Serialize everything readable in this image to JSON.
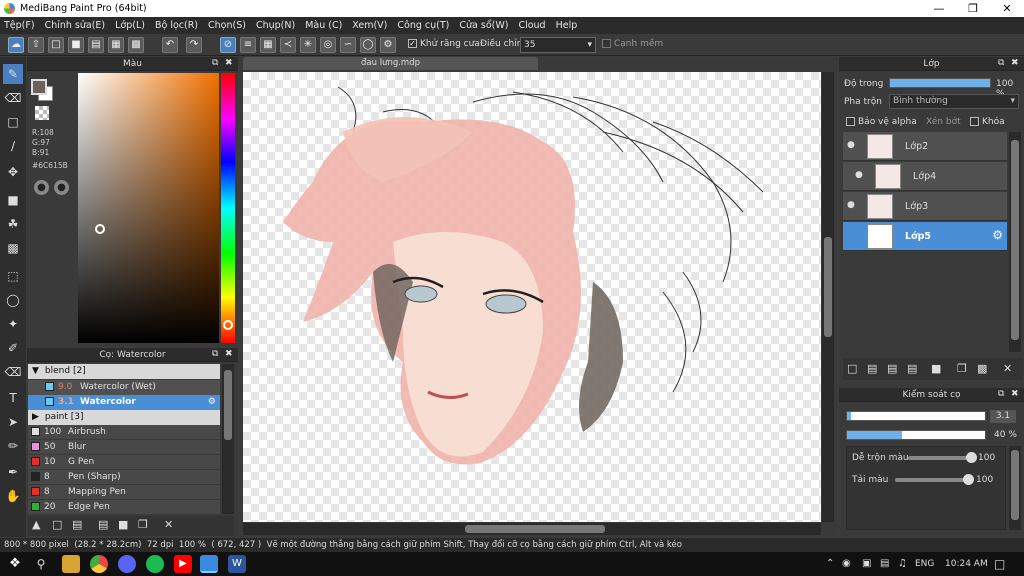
{
  "window": {
    "title": "MediBang Paint Pro (64bit)"
  },
  "menu": [
    "Tệp(F)",
    "Chỉnh sửa(E)",
    "Lớp(L)",
    "Bộ lọc(R)",
    "Chọn(S)",
    "Chụp(N)",
    "Màu (C)",
    "Xem(V)",
    "Công cụ(T)",
    "Cửa sổ(W)",
    "Cloud",
    "Help"
  ],
  "toolbar": {
    "antialias_label": "Khử răng cưa",
    "adjust_label": "Điều chỉnh",
    "adjust_value": "35",
    "smooth_edge_label": "Cạnh mềm"
  },
  "color_panel": {
    "title": "Màu",
    "r": "R:108",
    "g": "G:97",
    "b": "B:91",
    "hex": "#6C615B",
    "primary_color": "#6c615b",
    "secondary_color": "#ffffff"
  },
  "brush_panel": {
    "title": "Cọ: Watercolor",
    "groups": [
      {
        "name": "blend [2]",
        "expanded": true
      },
      {
        "name": "paint [3]",
        "expanded": false
      }
    ],
    "blend_items": [
      {
        "size": "9.0",
        "name": "Watercolor (Wet)",
        "color": "#6ec9f0",
        "selected": false
      },
      {
        "size": "3.1",
        "name": "Watercolor",
        "color": "#6ec9f0",
        "selected": true
      }
    ],
    "items": [
      {
        "size": "100",
        "name": "Airbrush",
        "color": "#dddddd"
      },
      {
        "size": "50",
        "name": "Blur",
        "color": "#e890e0"
      },
      {
        "size": "10",
        "name": "G Pen",
        "color": "#e03030"
      },
      {
        "size": "8",
        "name": "Pen (Sharp)",
        "color": "#222222"
      },
      {
        "size": "8",
        "name": "Mapping Pen",
        "color": "#e03030"
      },
      {
        "size": "20",
        "name": "Edge Pen",
        "color": "#30b030"
      }
    ]
  },
  "canvas": {
    "tab_title": "đau lưng.mdp"
  },
  "layer_panel": {
    "title": "Lớp",
    "opacity_label": "Độ trong",
    "opacity_value": "100 %",
    "opacity_fraction": 1.0,
    "blend_label": "Pha trộn",
    "blend_value": "Bình thường",
    "protect_alpha_label": "Bảo vệ alpha",
    "clipping_label": "Xén bớt",
    "lock_label": "Khóa",
    "layers": [
      {
        "name": "Lớp2",
        "selected": false
      },
      {
        "name": "Lớp4",
        "selected": false
      },
      {
        "name": "Lớp3",
        "selected": false
      },
      {
        "name": "Lớp5",
        "selected": true
      }
    ]
  },
  "brush_control": {
    "title": "Kiểm soát cọ",
    "size_value": "3.1",
    "size_fraction": 0.03,
    "opacity_value": "40 %",
    "opacity_fraction": 0.4,
    "blend_label": "Dễ trộn màu",
    "blend_value": "100",
    "blend_fraction": 1.0,
    "amount_label": "Tải màu",
    "amount_value": "100",
    "amount_fraction": 1.0
  },
  "status": {
    "size": "800 * 800 pixel",
    "cm": "(28.2 * 28.2cm)",
    "dpi": "72 dpi",
    "zoom": "100 %",
    "coords": "( 672, 427 )",
    "hint": "Vẽ một đường thẳng bằng cách giữ phím Shift, Thay đổi cỡ cọ bằng cách giữ phím Ctrl, Alt và kéo"
  },
  "taskbar": {
    "lang": "ENG",
    "time": "10:24 AM"
  }
}
